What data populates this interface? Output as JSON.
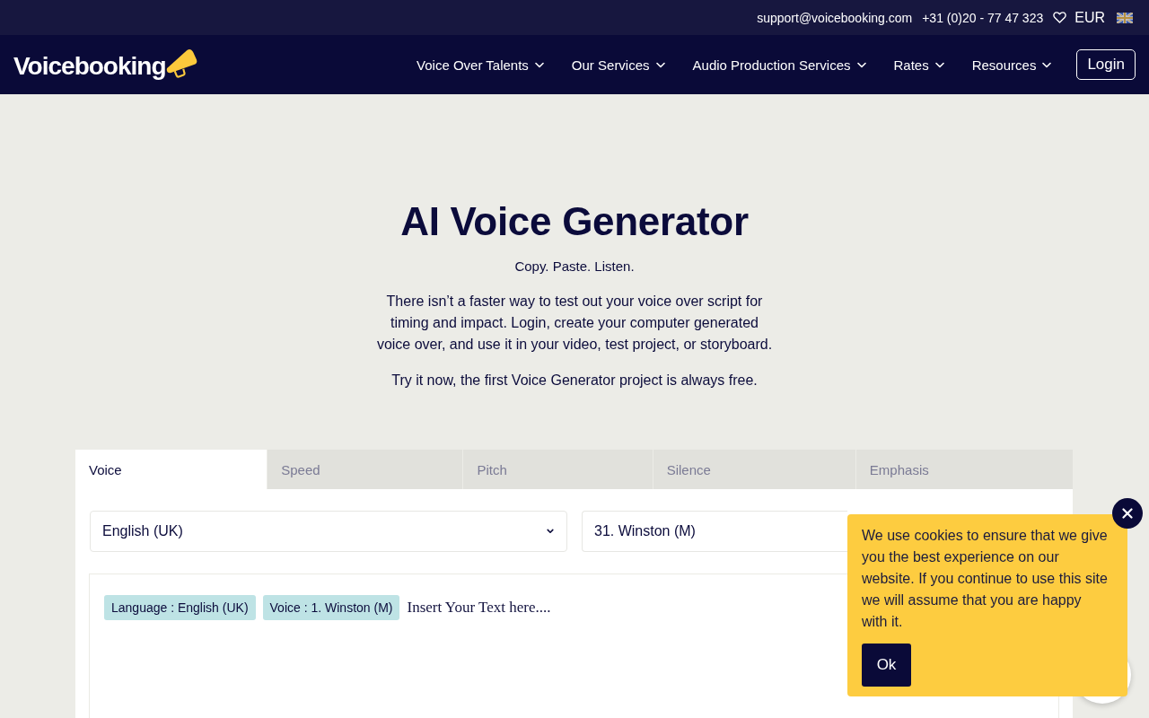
{
  "top_bar": {
    "email": "support@voicebooking.com",
    "phone": "+31 (0)20 - 77 47 323",
    "currency": "EUR"
  },
  "nav": {
    "logo": "Voicebooking",
    "items": [
      {
        "label": "Voice Over Talents"
      },
      {
        "label": "Our Services"
      },
      {
        "label": "Audio Production Services"
      },
      {
        "label": "Rates"
      },
      {
        "label": "Resources"
      }
    ],
    "login": "Login"
  },
  "hero": {
    "title": "AI Voice Generator",
    "tagline": "Copy. Paste. Listen.",
    "description": "There isn’t a faster way to test out your voice over script for timing and impact. Login, create your computer generated voice over, and use it in your video, test project, or storyboard.",
    "note": "Try it now, the first Voice Generator project is always free."
  },
  "generator": {
    "tabs": [
      {
        "label": "Voice",
        "selected": true
      },
      {
        "label": "Speed",
        "selected": false
      },
      {
        "label": "Pitch",
        "selected": false
      },
      {
        "label": "Silence",
        "selected": false
      },
      {
        "label": "Emphasis",
        "selected": false
      }
    ],
    "language_select": {
      "value": "English (UK)"
    },
    "voice_select": {
      "value": "31. Winston (M)"
    },
    "editor": {
      "tags": [
        {
          "label": "Language : English (UK)"
        },
        {
          "label": "Voice : 1. Winston (M)"
        }
      ],
      "placeholder": "Insert Your Text here...."
    }
  },
  "cookie_notice": {
    "message": "We use cookies to ensure that we give you the best experience on our website. If you continue to use this site we will assume that you are happy with it.",
    "button": "Ok"
  }
}
